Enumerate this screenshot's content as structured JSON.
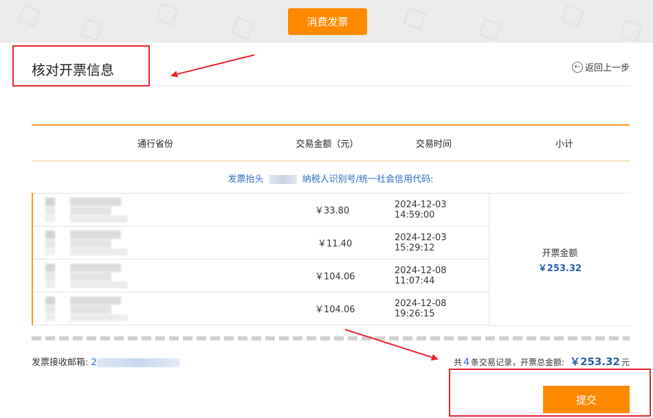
{
  "header": {
    "type_button_label": "消费发票"
  },
  "page": {
    "title": "核对开票信息",
    "back_label": "返回上一步"
  },
  "table": {
    "headers": [
      "通行省份",
      "交易金额（元）",
      "交易时间",
      "小计"
    ],
    "invoice_title_label": "发票抬头",
    "tax_id_label": "纳税人识别号/统一社会信用代码:",
    "rows": [
      {
        "amount": "￥33.80",
        "time": "2024-12-03 14:59:00"
      },
      {
        "amount": "￥11.40",
        "time": "2024-12-03 15:29:12"
      },
      {
        "amount": "￥104.06",
        "time": "2024-12-08 11:07:44"
      },
      {
        "amount": "￥104.06",
        "time": "2024-12-08 19:26:15"
      }
    ],
    "subtotal_label": "开票金额",
    "subtotal_value": "￥253.32"
  },
  "footer": {
    "email_label": "发票接收邮箱:",
    "email_value_prefix": "2",
    "summary_prefix": "共",
    "record_count": "4",
    "summary_mid": "条交易记录，开票总金额:",
    "total": "￥253.32",
    "unit": "元",
    "submit_label": "提交"
  },
  "colors": {
    "accent": "#ff8a00",
    "annotation": "#e8242a",
    "link": "#2a6bc0"
  }
}
